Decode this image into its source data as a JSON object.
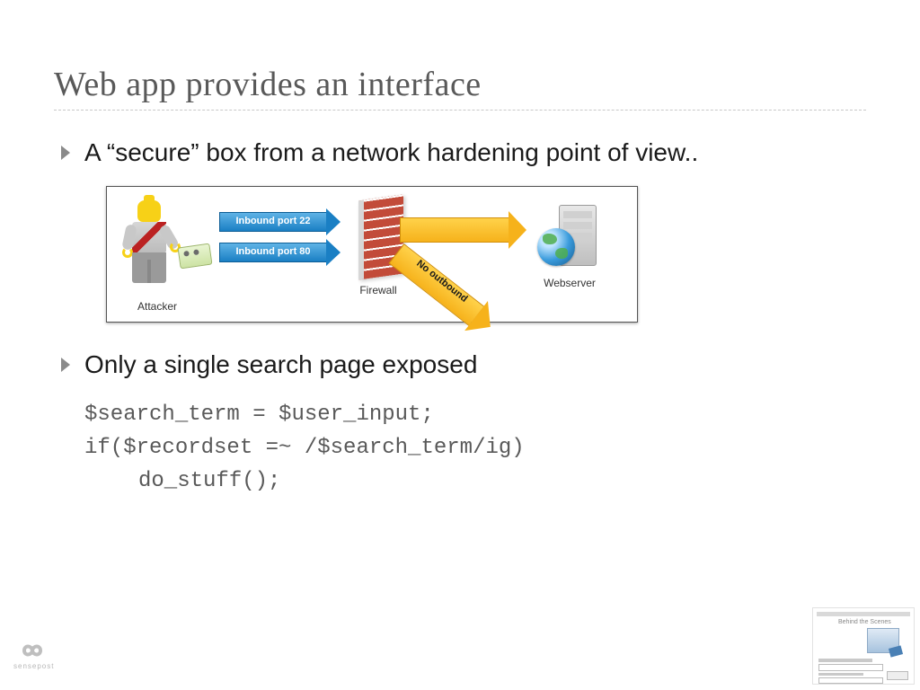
{
  "title": "Web app provides an interface",
  "bullets": {
    "b1": "A “secure” box from a network hardening point of view..",
    "b2": "Only a single search page exposed"
  },
  "diagram": {
    "attacker_label": "Attacker",
    "arrow1": "Inbound port 22",
    "arrow2": "Inbound port 80",
    "firewall_label": "Firewall",
    "no_outbound": "No outbound",
    "webserver_label": "Webserver"
  },
  "code": {
    "l1": "$search_term = $user_input;",
    "l2": "if($recordset =~ /$search_term/ig)",
    "l3": "do_stuff();"
  },
  "logo_text": "sensepost",
  "thumb_title": "Behind the Scenes"
}
